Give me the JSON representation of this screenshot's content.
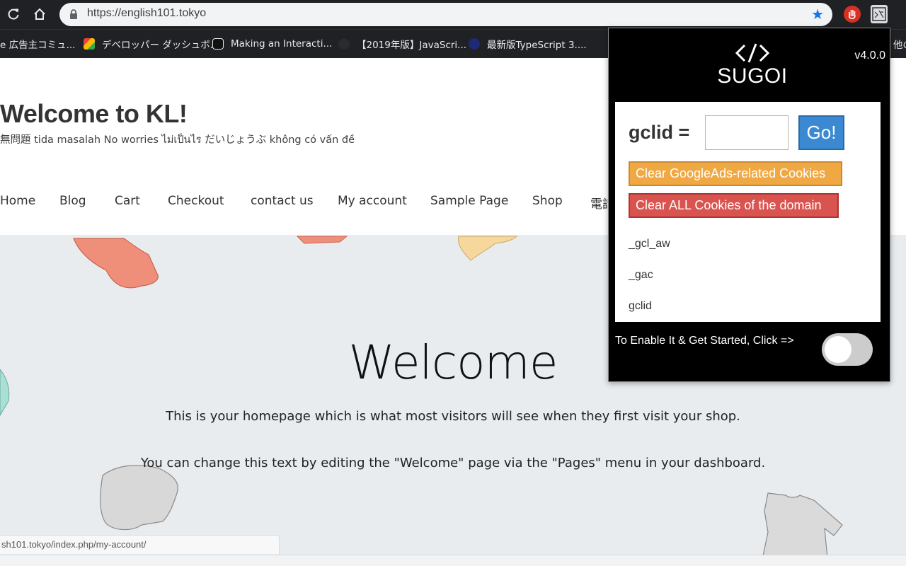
{
  "browser": {
    "url": "https://english101.tokyo",
    "bookmarks": [
      "e 広告主コミュ...",
      "デベロッパー ダッシュボ...",
      "Making an Interacti...",
      "【2019年版】JavaScri...",
      "最新版TypeScript 3....",
      "他の"
    ]
  },
  "site": {
    "title": "Welcome to KL!",
    "tagline": "無問題 tida masalah No worries ไม่เป็นไร だいじょうぶ không có vấn đề",
    "nav": [
      "Home",
      "Blog",
      "Cart",
      "Checkout",
      "contact us",
      "My account",
      "Sample Page",
      "Shop",
      "電話"
    ],
    "welcome_heading": "Welcome",
    "paragraph1": "This is your homepage which is what most visitors will see when they first visit your shop.",
    "paragraph2": "You can change this text by editing the \"Welcome\" page via the \"Pages\" menu in your dashboard.",
    "status_url": "sh101.tokyo/index.php/my-account/"
  },
  "popup": {
    "brand": "SUGOI",
    "version": "v4.0.0",
    "gclid_label": "gclid =",
    "gclid_value": "",
    "go_label": "Go!",
    "clear_ads_label": "Clear GoogleAds-related Cookies",
    "clear_all_label": "Clear ALL Cookies of the domain",
    "cookies": [
      "_gcl_aw",
      "_gac",
      "gclid"
    ],
    "enable_text": "To Enable It & Get Started, Click =>",
    "toggle_on": false
  },
  "colors": {
    "chrome_dark": "#202124",
    "go_button": "#3b89d2",
    "clear_ads_button": "#f0a843",
    "clear_all_button": "#d9534f",
    "hero_background": "#e8ecef"
  },
  "icons": [
    "reload-icon",
    "home-icon",
    "lock-icon",
    "star-icon",
    "stop-extension-icon",
    "sugoi-extension-icon",
    "code-icon"
  ]
}
